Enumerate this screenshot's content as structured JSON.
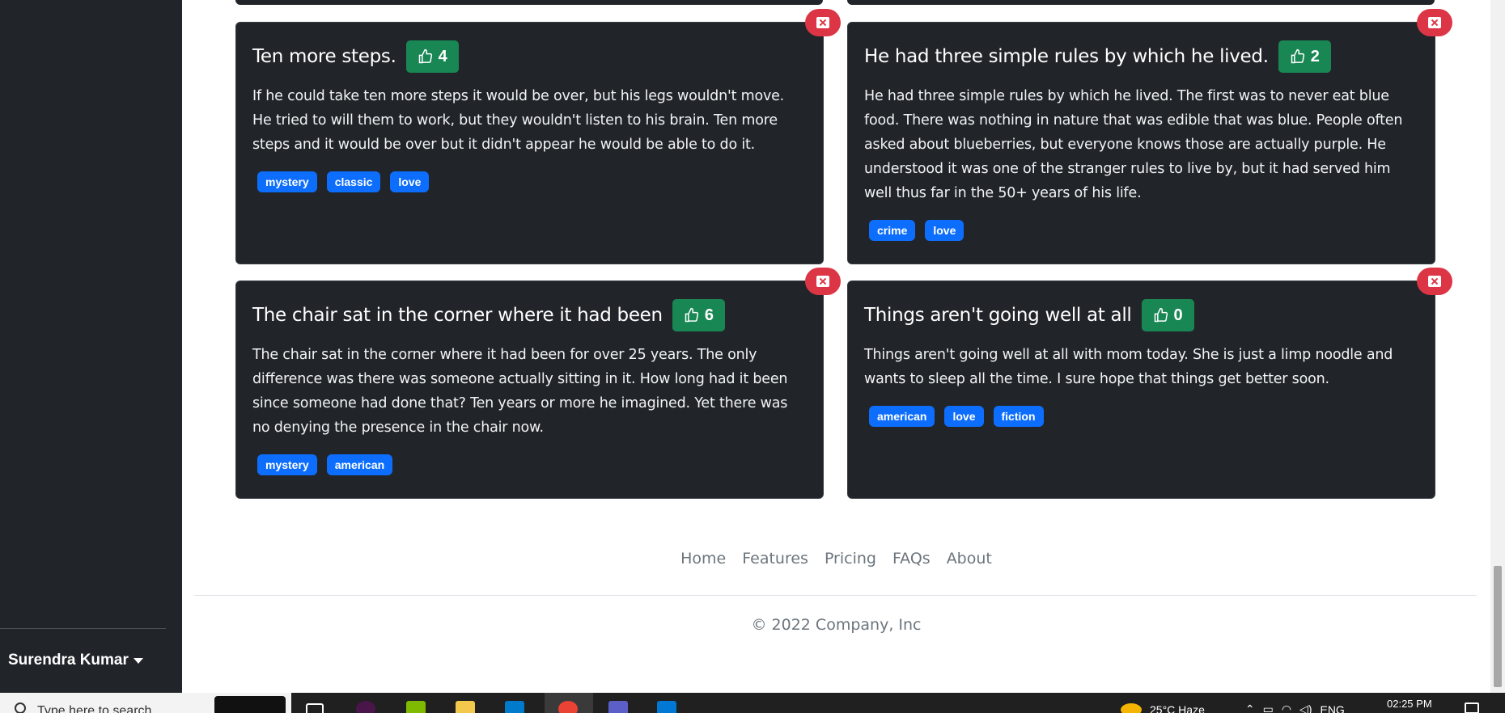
{
  "user": {
    "name": "Surendra Kumar"
  },
  "cards": [
    {
      "title": "Ten more steps.",
      "likes": "4",
      "text": "If he could take ten more steps it would be over, but his legs wouldn't move. He tried to will them to work, but they wouldn't listen to his brain. Ten more steps and it would be over but it didn't appear he would be able to do it.",
      "tags": [
        "mystery",
        "classic",
        "love"
      ]
    },
    {
      "title": "He had three simple rules by which he lived.",
      "likes": "2",
      "text": "He had three simple rules by which he lived. The first was to never eat blue food. There was nothing in nature that was edible that was blue. People often asked about blueberries, but everyone knows those are actually purple. He understood it was one of the stranger rules to live by, but it had served him well thus far in the 50+ years of his life.",
      "tags": [
        "crime",
        "love"
      ]
    },
    {
      "title": "The chair sat in the corner where it had been",
      "likes": "6",
      "text": "The chair sat in the corner where it had been for over 25 years. The only difference was there was someone actually sitting in it. How long had it been since someone had done that? Ten years or more he imagined. Yet there was no denying the presence in the chair now.",
      "tags": [
        "mystery",
        "american"
      ]
    },
    {
      "title": "Things aren't going well at all",
      "likes": "0",
      "text": "Things aren't going well at all with mom today. She is just a limp noodle and wants to sleep all the time. I sure hope that things get better soon.",
      "tags": [
        "american",
        "love",
        "fiction"
      ]
    }
  ],
  "footer": {
    "nav": [
      "Home",
      "Features",
      "Pricing",
      "FAQs",
      "About"
    ],
    "copyright": "© 2022 Company, Inc"
  },
  "taskbar": {
    "search_placeholder": "Type here to search",
    "weather": "25°C  Haze",
    "language": "ENG",
    "time": "02:25 PM"
  },
  "colors": {
    "sidebar_bg": "#212529",
    "card_bg": "#212529",
    "like_green": "#198754",
    "tag_blue": "#0d6efd",
    "delete_red": "#dc3545"
  }
}
